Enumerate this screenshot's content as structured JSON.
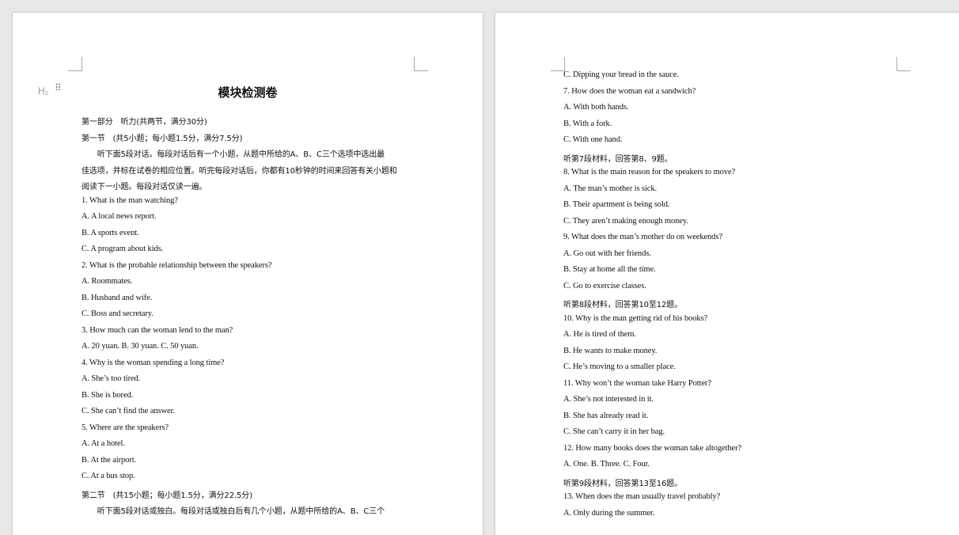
{
  "doc": {
    "heading_tag": "H₂",
    "title": "模块检测卷",
    "page1": [
      "第一部分　听力(共两节，满分30分)",
      "第一节　(共5小题；每小题1.5分，满分7.5分)",
      "　　听下面5段对话。每段对话后有一个小题，从题中所给的A、B、C三个选项中选出最",
      "佳选项，并标在试卷的相应位置。听完每段对话后，你都有10秒钟的时间来回答有关小题和",
      "阅读下一小题。每段对话仅读一遍。",
      "1.  What is the man watching?",
      "A.  A local news report.",
      "B.  A sports event.",
      "C.  A program about kids.",
      "2.  What is the probable relationship between the speakers?",
      "A.  Roommates.",
      "B.  Husband and wife.",
      "C.  Boss and secretary.",
      "3.  How much can the woman lend to the man?",
      "A.  20 yuan.    B.  30 yuan.    C.  50 yuan.",
      "4.  Why is the woman spending a long time?",
      "A.  She’s too tired.",
      "B.  She is bored.",
      "C.  She can’t find the answer.",
      "5.  Where are the speakers?",
      "A.  At a hotel.",
      "B.  At the airport.",
      "C.  At a bus stop.",
      "第二节　(共15小题；每小题1.5分，满分22.5分)",
      "　　听下面5段对话或独白。每段对话或独白后有几个小题，从题中所给的A、B、C三个"
    ],
    "page2": [
      "C.  Dipping your bread in the sauce.",
      "7.  How does the woman eat a sandwich?",
      "A.  With both hands.",
      "B.  With a fork.",
      "C.  With one hand.",
      "听第7段材料，回答第8、9题。",
      "8.  What is the main reason for the speakers to move?",
      "A.  The man’s mother is sick.",
      "B.  Their apartment is being sold.",
      "C.  They aren’t making enough money.",
      "9.  What does the man’s mother do on weekends?",
      "A.  Go out with her friends.",
      "B.  Stay at home all the time.",
      "C.  Go to exercise classes.",
      "听第8段材料，回答第10至12题。",
      "10.  Why is the man getting rid of his books?",
      "A.  He is tired of them.",
      "B.  He wants to make money.",
      "C.  He’s moving to a smaller place.",
      "11.  Why won’t the woman take Harry Potter?",
      "A.  She’s not interested in it.",
      "B.  She has already read it.",
      "C.  She can’t carry it in her bag.",
      "12.  How many books does the woman take altogether?",
      "A.  One.    B.  Three.    C.  Four.",
      "听第9段材料，回答第13至16题。",
      "13.  When does the man usually travel probably?",
      "A.  Only during the summer."
    ]
  }
}
